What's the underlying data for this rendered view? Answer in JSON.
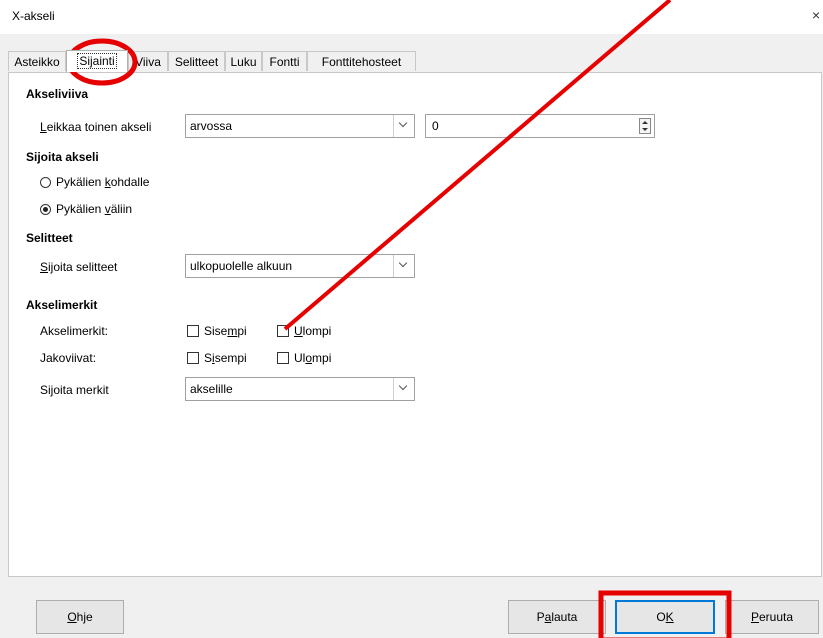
{
  "window": {
    "title": "X-akseli",
    "close_glyph": "×"
  },
  "tabs": [
    {
      "label": "Asteikko"
    },
    {
      "label": "Sijainti"
    },
    {
      "label": "Viiva"
    },
    {
      "label": "Selitteet"
    },
    {
      "label": "Luku"
    },
    {
      "label": "Fontti"
    },
    {
      "label": "Fonttitehosteet"
    }
  ],
  "akseliviiva": {
    "heading": "Akseliviiva",
    "cross_label_pre": "",
    "cross_label_ul": "L",
    "cross_label_post": "eikkaa toinen akseli",
    "cross_value": "arvossa",
    "cross_number": "0"
  },
  "sijoita_akseli": {
    "heading": "Sijoita akseli",
    "opt1_pre": "Pykälien ",
    "opt1_ul": "k",
    "opt1_post": "ohdalle",
    "opt2_pre": "Pykälien ",
    "opt2_ul": "v",
    "opt2_post": "äliin",
    "selected": "opt2"
  },
  "selitteet": {
    "heading": "Selitteet",
    "label_pre": "",
    "label_ul": "S",
    "label_post": "ijoita selitteet",
    "value": "ulkopuolelle alkuun"
  },
  "akselimerkit": {
    "heading": "Akselimerkit",
    "row1_label": "Akselimerkit:",
    "row1_inner_pre": "Sise",
    "row1_inner_ul": "m",
    "row1_inner_post": "pi",
    "row1_outer_pre": "",
    "row1_outer_ul": "U",
    "row1_outer_post": "lompi",
    "row2_label": "Jakoviivat:",
    "row2_inner_pre": "S",
    "row2_inner_ul": "i",
    "row2_inner_post": "sempi",
    "row2_outer_pre": "Ul",
    "row2_outer_ul": "o",
    "row2_outer_post": "mpi",
    "place_label_pre": "Si",
    "place_label_ul": "j",
    "place_label_post": "oita merkit",
    "place_value": "akselille"
  },
  "buttons": {
    "help_pre": "",
    "help_ul": "O",
    "help_post": "hje",
    "reset_pre": "P",
    "reset_ul": "a",
    "reset_post": "lauta",
    "ok_pre": "O",
    "ok_ul": "K",
    "ok_post": "",
    "cancel_pre": "",
    "cancel_ul": "P",
    "cancel_post": "eruuta"
  },
  "annotation_color": "#e60000"
}
